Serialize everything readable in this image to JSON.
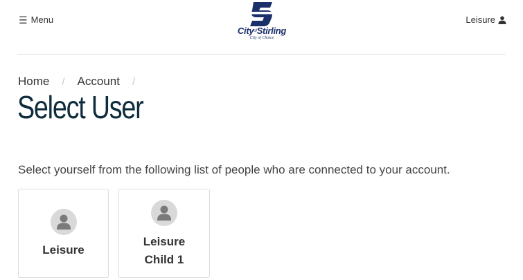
{
  "header": {
    "menu_label": "Menu",
    "logo_text": "City of Stirling",
    "logo_text_main1": "City",
    "logo_text_of": "of",
    "logo_text_main2": "Stirling",
    "logo_tagline": "City of Choice",
    "user_label": "Leisure"
  },
  "breadcrumb": [
    "Home",
    "Account"
  ],
  "page_title": "Select User",
  "intro_text": "Select yourself from the following list of people who are connected to your account.",
  "users": [
    {
      "line1": "Leisure",
      "line2": ""
    },
    {
      "line1": "Leisure",
      "line2": "Child 1"
    }
  ],
  "colors": {
    "brand": "#1b2f6b",
    "title": "#0e2c3b",
    "avatar_bg": "#d9d9d9",
    "avatar_fg": "#7a7a7a"
  }
}
